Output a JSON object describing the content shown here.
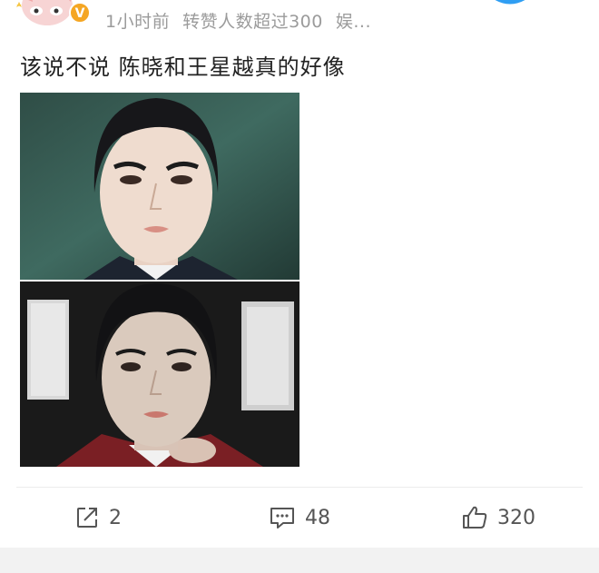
{
  "post": {
    "time": "1小时前",
    "repost_note": "转赞人数超过300",
    "source": "娱...",
    "text": "该说不说 陈晓和王星越真的好像",
    "avatar_icon": "cartoon-avatar-icon",
    "verified_badge": "V"
  },
  "images": [
    {
      "name": "portrait-photo-top"
    },
    {
      "name": "portrait-photo-bottom"
    }
  ],
  "actions": {
    "share_count": "2",
    "comment_count": "48",
    "like_count": "320",
    "share_icon": "share-icon",
    "comment_icon": "comment-icon",
    "like_icon": "thumbs-up-icon"
  },
  "colors": {
    "meta_text": "#9b9b9b",
    "badge_orange": "#f5a623",
    "avatar_pink": "#f7c9c9",
    "top_badge_blue": "#2f9ef3"
  }
}
